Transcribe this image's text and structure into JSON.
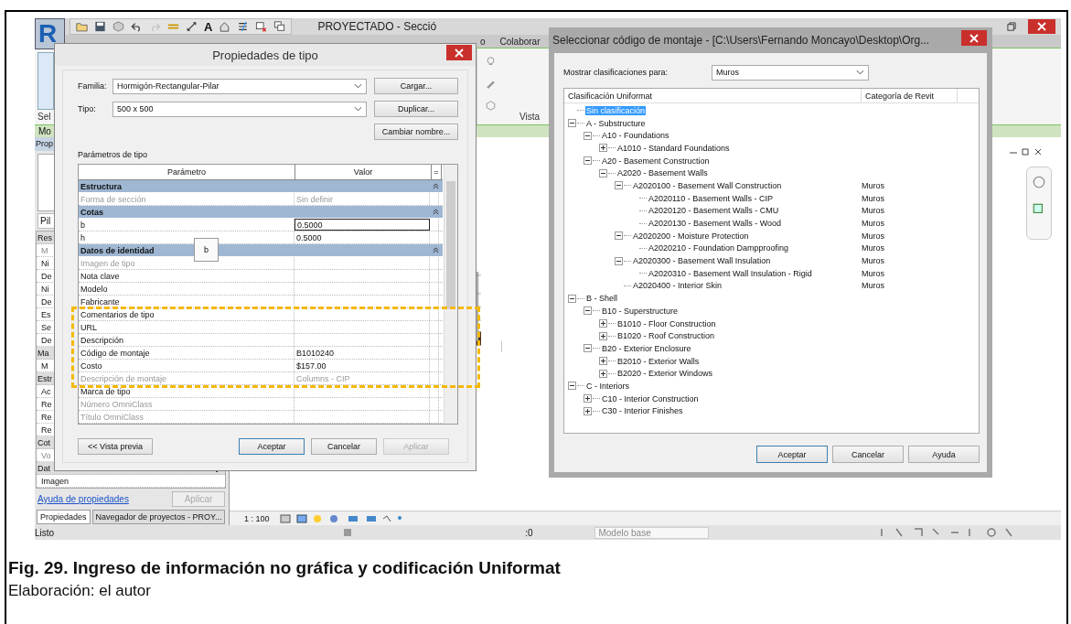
{
  "revit": {
    "logo": "R",
    "title": "PROYECTADO - Secció",
    "text_tool": "A",
    "ribbon_tabs": [
      {
        "label": "o",
        "selected": false
      },
      {
        "label": "Colaborar",
        "selected": false
      }
    ],
    "ribbon_panel": "Vista",
    "select_panel": "Sel",
    "context_tab": "Mo",
    "properties": {
      "title": "Prop",
      "type_name": "Pil",
      "rows": [
        {
          "text": "Res",
          "kind": "group"
        },
        {
          "text": "M",
          "kind": "readonly"
        },
        {
          "text": "Ni",
          "kind": "param"
        },
        {
          "text": "De",
          "kind": "param"
        },
        {
          "text": "Ni",
          "kind": "param"
        },
        {
          "text": "De",
          "kind": "param"
        },
        {
          "text": "Es",
          "kind": "param"
        },
        {
          "text": "Se",
          "kind": "param"
        },
        {
          "text": "De",
          "kind": "param"
        },
        {
          "text": "Ma",
          "kind": "group"
        },
        {
          "text": "M",
          "kind": "param"
        },
        {
          "text": "Estr",
          "kind": "group"
        },
        {
          "text": "Ac",
          "kind": "param"
        },
        {
          "text": "Re",
          "kind": "param"
        },
        {
          "text": "Re",
          "kind": "param"
        },
        {
          "text": "Re",
          "kind": "param"
        },
        {
          "text": "Cot",
          "kind": "group"
        },
        {
          "text": "Vo",
          "kind": "readonly"
        },
        {
          "text": "Dat",
          "kind": "group"
        },
        {
          "text": "Imagen",
          "kind": "param"
        }
      ],
      "help_link": "Ayuda de propiedades",
      "apply": "Aplicar",
      "apply_disabled": true
    },
    "browser_tabs": [
      {
        "label": "Propiedades",
        "selected": true
      },
      {
        "label": "Navegador de proyectos - PROY...",
        "selected": false
      }
    ],
    "view_scale": "1 : 100",
    "status": "Listo",
    "worksets": ":0",
    "model": "Modelo base"
  },
  "type_dialog": {
    "title": "Propiedades de tipo",
    "family_label": "Familia:",
    "family": "Hormigón-Rectangular-Pilar",
    "type_label": "Tipo:",
    "type": "500 x 500",
    "side_buttons": [
      "Cargar...",
      "Duplicar...",
      "Cambiar nombre..."
    ],
    "params_label": "Parámetros de tipo",
    "columns": [
      "Parámetro",
      "Valor",
      "="
    ],
    "groups": [
      {
        "name": "Estructura",
        "rows": [
          {
            "param": "Forma de sección",
            "value": "Sin definir",
            "disabled": true,
            "focused": false
          }
        ]
      },
      {
        "name": "Cotas",
        "rows": [
          {
            "param": "b",
            "value": "0.5000",
            "disabled": false,
            "focused": true
          },
          {
            "param": "h",
            "value": "0.5000",
            "disabled": false,
            "focused": false
          }
        ]
      },
      {
        "name": "Datos de identidad",
        "rows": [
          {
            "param": "Imagen de tipo",
            "disabled": true,
            "focused": false
          },
          {
            "param": "Nota clave",
            "disabled": false,
            "focused": false
          },
          {
            "param": "Modelo",
            "disabled": false,
            "focused": false
          },
          {
            "param": "Fabricante",
            "disabled": false,
            "focused": false
          },
          {
            "param": "Comentarios de tipo",
            "disabled": false,
            "focused": false
          },
          {
            "param": "URL",
            "disabled": false,
            "focused": false
          },
          {
            "param": "Descripción",
            "disabled": false,
            "focused": false
          },
          {
            "param": "Código de montaje",
            "value": "B1010240",
            "disabled": false,
            "focused": false
          },
          {
            "param": "Costo",
            "value": "$157.00",
            "disabled": false,
            "focused": false
          },
          {
            "param": "Descripción de montaje",
            "value": "Columns - CIP",
            "disabled": true,
            "focused": false
          },
          {
            "param": "Marca de tipo",
            "disabled": false,
            "focused": false
          },
          {
            "param": "Número OmniClass",
            "disabled": true,
            "focused": false
          },
          {
            "param": "Título OmniClass",
            "disabled": true,
            "focused": false
          }
        ]
      }
    ],
    "tooltip": "b",
    "preview": "<< Vista previa",
    "buttons": [
      {
        "label": "Aceptar",
        "kind": "default"
      },
      {
        "label": "Cancelar",
        "kind": "normal"
      },
      {
        "label": "Aplicar",
        "kind": "disabled"
      }
    ]
  },
  "uniformat_dialog": {
    "title": "Seleccionar código de montaje - [C:\\Users\\Fernando Moncayo\\Desktop\\Org...",
    "show_label": "Mostrar clasificaciones para:",
    "show_value": "Muros",
    "columns": [
      "Clasificación Uniformat",
      "Categoría de Revit"
    ],
    "tree": [
      {
        "label": "Sin clasificación",
        "selected": true
      },
      {
        "label": "A - Substructure",
        "expanded": true,
        "selected": false,
        "children": [
          {
            "label": "A10 - Foundations",
            "expanded": true,
            "selected": false,
            "children": [
              {
                "label": "A1010 - Standard Foundations",
                "expanded": false,
                "selected": false
              }
            ]
          },
          {
            "label": "A20 - Basement Construction",
            "expanded": true,
            "selected": false,
            "children": [
              {
                "label": "A2020 - Basement Walls",
                "expanded": true,
                "selected": false,
                "children": [
                  {
                    "label": "A2020100 - Basement Wall Construction",
                    "category": "Muros",
                    "expanded": true,
                    "selected": false,
                    "children": [
                      {
                        "label": "A2020110 - Basement Walls - CIP",
                        "category": "Muros",
                        "selected": false
                      },
                      {
                        "label": "A2020120 - Basement Walls - CMU",
                        "category": "Muros",
                        "selected": false
                      },
                      {
                        "label": "A2020130 - Basement Walls - Wood",
                        "category": "Muros",
                        "selected": false
                      }
                    ]
                  },
                  {
                    "label": "A2020200 - Moisture Protection",
                    "category": "Muros",
                    "expanded": true,
                    "selected": false,
                    "children": [
                      {
                        "label": "A2020210 - Foundation Dampproofing",
                        "category": "Muros",
                        "selected": false
                      }
                    ]
                  },
                  {
                    "label": "A2020300 - Basement Wall Insulation",
                    "category": "Muros",
                    "expanded": true,
                    "selected": false,
                    "children": [
                      {
                        "label": "A2020310 - Basement Wall Insulation - Rigid",
                        "category": "Muros",
                        "selected": false
                      }
                    ]
                  },
                  {
                    "label": "A2020400 - Interior Skin",
                    "category": "Muros",
                    "selected": false
                  }
                ]
              }
            ]
          }
        ]
      },
      {
        "label": "B - Shell",
        "expanded": true,
        "selected": false,
        "children": [
          {
            "label": "B10 - Superstructure",
            "expanded": true,
            "selected": false,
            "children": [
              {
                "label": "B1010 - Floor Construction",
                "expanded": false,
                "selected": false
              },
              {
                "label": "B1020 - Roof Construction",
                "expanded": false,
                "selected": false
              }
            ]
          },
          {
            "label": "B20 - Exterior Enclosure",
            "expanded": true,
            "selected": false,
            "children": [
              {
                "label": "B2010 - Exterior Walls",
                "expanded": false,
                "selected": false
              },
              {
                "label": "B2020 - Exterior Windows",
                "expanded": false,
                "selected": false
              }
            ]
          }
        ]
      },
      {
        "label": "C - Interiors",
        "expanded": true,
        "selected": false,
        "children": [
          {
            "label": "C10 - Interior Construction",
            "expanded": false,
            "selected": false
          },
          {
            "label": "C30 - Interior Finishes",
            "expanded": false,
            "selected": false
          }
        ]
      }
    ],
    "buttons": [
      {
        "label": "Aceptar",
        "kind": "default"
      },
      {
        "label": "Cancelar",
        "kind": "normal"
      },
      {
        "label": "Ayuda",
        "kind": "normal"
      }
    ]
  },
  "caption": {
    "title": "Fig. 29. Ingreso de información no gráfica y codificación Uniformat",
    "credit": "Elaboración: el autor"
  }
}
